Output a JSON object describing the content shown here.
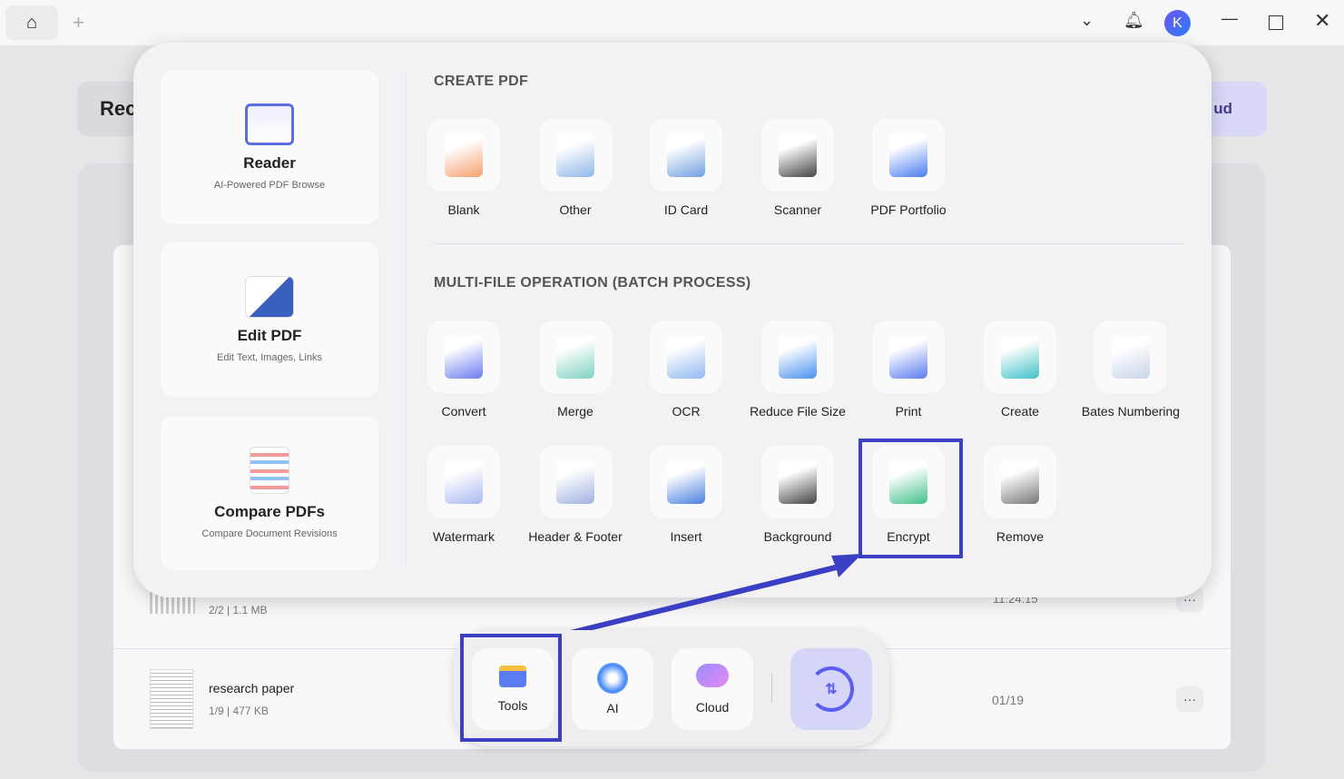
{
  "titlebar": {
    "avatar_letter": "K",
    "icons": [
      "home-icon",
      "plus-icon",
      "chevron-down-icon",
      "bell-icon",
      "minimize-icon",
      "maximize-icon",
      "close-icon"
    ]
  },
  "background": {
    "left_button": "Rec",
    "right_button": "ud",
    "files": [
      {
        "meta": "2/2 | 1.1 MB",
        "date": "11:24:15"
      },
      {
        "name": "research paper",
        "meta": "1/9 | 477 KB",
        "date": "01/19"
      }
    ]
  },
  "popup": {
    "cards": [
      {
        "title": "Reader",
        "subtitle": "AI-Powered PDF Browse"
      },
      {
        "title": "Edit PDF",
        "subtitle": "Edit Text, Images, Links"
      },
      {
        "title": "Compare PDFs",
        "subtitle": "Compare Document Revisions"
      }
    ],
    "create_title": "CREATE PDF",
    "create_items": [
      "Blank",
      "Other",
      "ID Card",
      "Scanner",
      "PDF Portfolio"
    ],
    "batch_title": "MULTI-FILE OPERATION (BATCH PROCESS)",
    "batch_row1": [
      "Convert",
      "Merge",
      "OCR",
      "Reduce File Size",
      "Print",
      "Create",
      "Bates Numbering"
    ],
    "batch_row2": [
      "Watermark",
      "Header & Footer",
      "Insert",
      "Background",
      "Encrypt",
      "Remove"
    ]
  },
  "dock": {
    "items": [
      "Tools",
      "AI",
      "Cloud"
    ]
  },
  "colors": {
    "highlight": "#3a3fc4",
    "accent": "#5b5ef0"
  }
}
